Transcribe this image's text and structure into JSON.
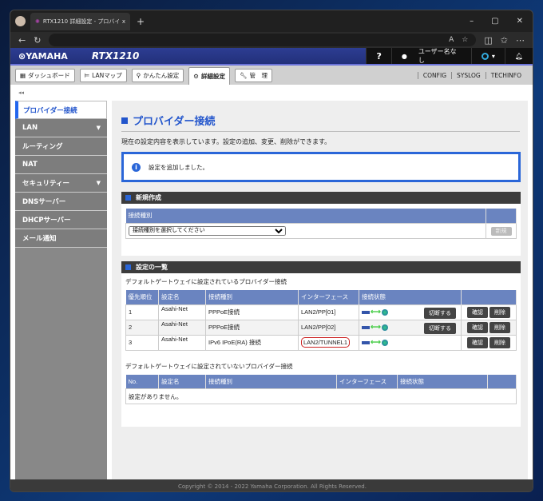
{
  "browser": {
    "tab_title": "RTX1210 詳細設定 - プロバイダー接",
    "new_tab": "+",
    "close": "x"
  },
  "header": {
    "logo": "⊛YAMAHA",
    "model": "RTX1210",
    "help": "?",
    "user": "ユーザー名なし"
  },
  "nav": {
    "items": [
      "ダッシュボード",
      "LANマップ",
      "かんたん設定",
      "詳細設定",
      "管　理"
    ],
    "links": [
      "CONFIG",
      "SYSLOG",
      "TECHINFO"
    ]
  },
  "sidebar": {
    "collapse": "◂◂",
    "items": [
      {
        "label": "プロバイダー接続"
      },
      {
        "label": "LAN",
        "arrow": "▼"
      },
      {
        "label": "ルーティング"
      },
      {
        "label": "NAT"
      },
      {
        "label": "セキュリティー",
        "arrow": "▼"
      },
      {
        "label": "DNSサーバー"
      },
      {
        "label": "DHCPサーバー"
      },
      {
        "label": "メール通知"
      }
    ]
  },
  "main": {
    "title": "プロバイダー接続",
    "description": "現在の設定内容を表示しています。設定の追加、変更、削除ができます。",
    "notice": "設定を追加しました。",
    "new_section": {
      "heading": "新規作成",
      "column": "接続種別",
      "select_value": "接続種別を選択してください",
      "new_button": "新規"
    },
    "list_section": {
      "heading": "設定の一覧",
      "default_caption": "デフォルトゲートウェイに設定されているプロバイダー接続",
      "columns": [
        "優先順位",
        "設定名",
        "接続種別",
        "インターフェース",
        "接続状態"
      ],
      "rows": [
        {
          "priority": "1",
          "name": "Asahi-Net",
          "type": "PPPoE接続",
          "interface": "LAN2/PP[01]",
          "disconnect": "切断する"
        },
        {
          "priority": "2",
          "name": "Asahi-Net",
          "type": "PPPoE接続",
          "interface": "LAN2/PP[02]",
          "disconnect": "切断する"
        },
        {
          "priority": "3",
          "name": "Asahi-Net",
          "type": "IPv6 IPoE(RA) 接続",
          "interface": "LAN2/TUNNEL1"
        }
      ],
      "confirm": "確認",
      "delete": "削除",
      "other_caption": "デフォルトゲートウェイに設定されていないプロバイダー接続",
      "other_columns": [
        "No.",
        "設定名",
        "接続種別",
        "インターフェース",
        "接続状態"
      ],
      "empty": "設定がありません。"
    }
  },
  "footer": "Copyright © 2014 - 2022 Yamaha Corporation. All Rights Reserved."
}
